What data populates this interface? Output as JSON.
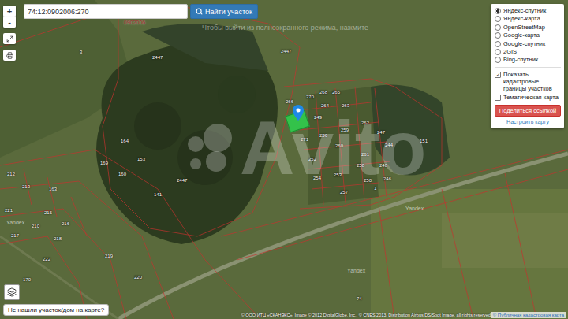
{
  "search": {
    "value": "74:12:0902006:270",
    "button": "Найти участок"
  },
  "zoom": {
    "in": "+",
    "out": "-"
  },
  "fullscreen_notice": "Чтобы выйти из полноэкранного режима, нажмите",
  "quarter_label": "0902006",
  "layers": [
    {
      "label": "Яндекс-спутник",
      "selected": true
    },
    {
      "label": "Яндекс-карта",
      "selected": false
    },
    {
      "label": "OpenStreetMap",
      "selected": false
    },
    {
      "label": "Google-карта",
      "selected": false
    },
    {
      "label": "Google-спутник",
      "selected": false
    },
    {
      "label": "2GIS",
      "selected": false
    },
    {
      "label": "Bing-спутник",
      "selected": false
    }
  ],
  "options": [
    {
      "label": "Показать кадастровые границы участков",
      "checked": true
    },
    {
      "label": "Тематическая карта",
      "checked": false
    }
  ],
  "share_button": "Поделиться ссылкой",
  "settings_link": "Настроить карту",
  "parcel_labels": [
    "3",
    "2447",
    "2447",
    "266",
    "270",
    "268",
    "265",
    "264",
    "263",
    "249",
    "262",
    "271",
    "256",
    "259",
    "247",
    "260",
    "244",
    "151",
    "261",
    "252",
    "258",
    "248",
    "254",
    "253",
    "250",
    "246",
    "257",
    "164",
    "169",
    "153",
    "160",
    "2447",
    "141",
    "163",
    "212",
    "213",
    "221",
    "215",
    "210",
    "216",
    "217",
    "218",
    "222",
    "219",
    "220",
    "170",
    "74",
    "1"
  ],
  "tile_marks": [
    "Yandex",
    "Yandex",
    "Yandex"
  ],
  "not_found_button": "Не нашли участок/дом на карте?",
  "attribution": "© ООО ИТЦ «СКАНЭКС», Image © 2012 DigitalGlobe, Inc., © CNES 2013, Distribution Airbus DS/Spot Image, all rights reserved",
  "cadastre_credit": "© Публичная кадастровая карта",
  "watermark": "Avito"
}
